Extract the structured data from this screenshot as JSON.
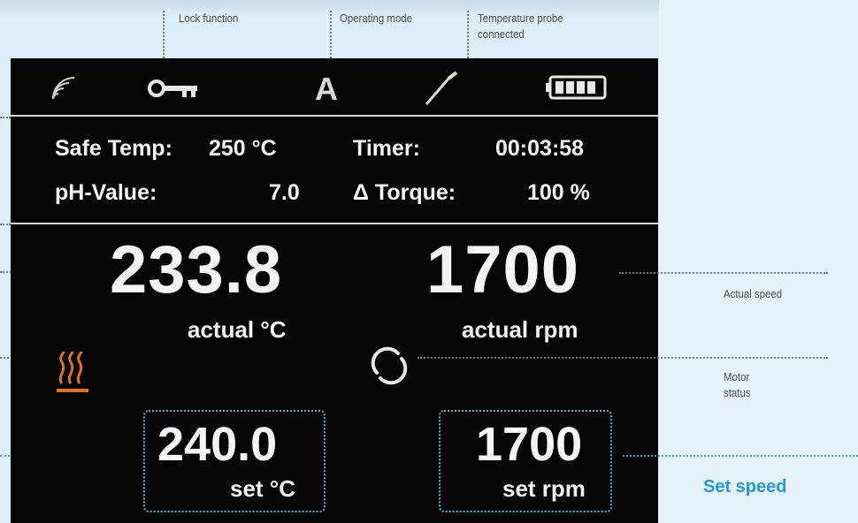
{
  "annotations": {
    "lock_function": "Lock function",
    "operating_mode": "Operating mode",
    "temperature_probe": "Temperature probe connected",
    "actual_speed": "Actual speed",
    "motor_status": "Motor status",
    "set_speed": "Set speed"
  },
  "status_bar": {
    "icons": [
      "signal-icon",
      "key-icon",
      "mode-icon",
      "probe-icon",
      "battery-icon"
    ],
    "operating_mode_letter": "A"
  },
  "info": {
    "safe_temp_label": "Safe Temp:",
    "safe_temp_value": "250 °C",
    "timer_label": "Timer:",
    "timer_value": "00:03:58",
    "ph_label": "pH-Value:",
    "ph_value": "7.0",
    "torque_label": "Δ Torque:",
    "torque_value": "100 %"
  },
  "readings": {
    "actual_temp": "233.8",
    "actual_temp_unit": "actual °C",
    "actual_speed": "1700",
    "actual_speed_unit": "actual rpm",
    "set_temp": "240.0",
    "set_temp_unit": "set °C",
    "set_speed": "1700",
    "set_speed_unit": "set rpm"
  },
  "colors": {
    "heating_icon": "#e0731e",
    "set_speed_label": "#1f9bd1",
    "screen_bg": "#050505"
  }
}
